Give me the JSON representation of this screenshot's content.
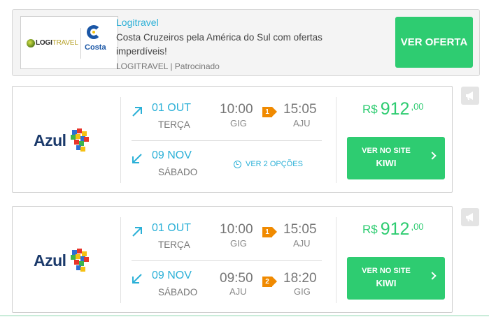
{
  "ad": {
    "logo_logitravel_a": "LOGI",
    "logo_logitravel_b": "TRAVEL",
    "logo_costa": "Costa",
    "title": "Logitravel",
    "description": "Costa Cruzeiros pela América do Sul com ofertas imperdíveis!",
    "source": "LOGITRAVEL | Patrocinado",
    "cta": "VER OFERTA"
  },
  "flights": [
    {
      "airline": "Azul",
      "outbound": {
        "date": "01 OUT",
        "weekday": "TERÇA",
        "dep_time": "10:00",
        "dep_code": "GIG",
        "stops": "1",
        "arr_time": "15:05",
        "arr_code": "AJU"
      },
      "return": {
        "date": "09 NOV",
        "weekday": "SÁBADO",
        "options": "VER 2 OPÇÕES"
      },
      "price": {
        "currency": "R$",
        "integer": "912",
        "decimals": ",00"
      },
      "cta": {
        "line1": "VER NO SITE",
        "line2": "KIWI"
      }
    },
    {
      "airline": "Azul",
      "outbound": {
        "date": "01 OUT",
        "weekday": "TERÇA",
        "dep_time": "10:00",
        "dep_code": "GIG",
        "stops": "1",
        "arr_time": "15:05",
        "arr_code": "AJU"
      },
      "return": {
        "date": "09 NOV",
        "weekday": "SÁBADO",
        "dep_time": "09:50",
        "dep_code": "AJU",
        "stops": "2",
        "arr_time": "18:20",
        "arr_code": "GIG"
      },
      "price": {
        "currency": "R$",
        "integer": "912",
        "decimals": ",00"
      },
      "cta": {
        "line1": "VER NO SITE",
        "line2": "KIWI"
      }
    }
  ],
  "colors": {
    "accent_blue": "#2bb0d7",
    "green": "#2ecc71",
    "stop_orange": "#f08a00",
    "azul_navy": "#1b3a6b"
  },
  "icons": {
    "outbound": "arrow-up-right-icon",
    "return": "arrow-down-left-icon",
    "clock": "clock-icon",
    "report": "megaphone-icon",
    "chevron": "chevron-right-icon"
  }
}
